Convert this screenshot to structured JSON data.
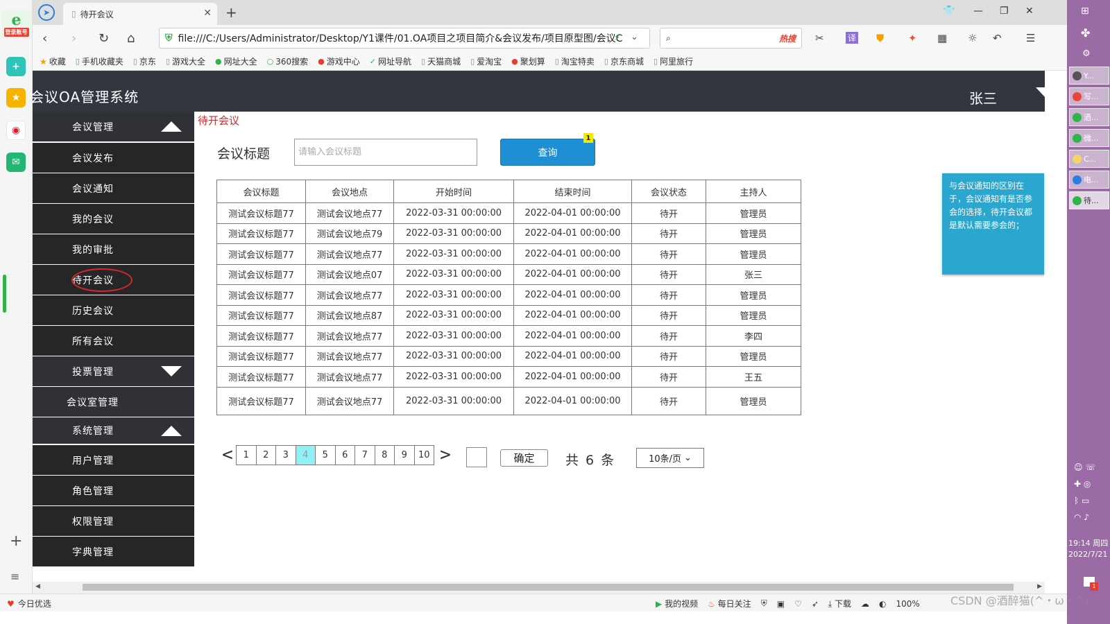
{
  "browser": {
    "tab_title": "待开会议",
    "url": "file:///C:/Users/Administrator/Desktop/Y1课件/01.OA项目之项目简介&会议发布/项目原型图/会议C",
    "search_hot": "热搜",
    "bookmarks": [
      "收藏",
      "手机收藏夹",
      "京东",
      "游戏大全",
      "网址大全",
      "360搜索",
      "游戏中心",
      "网址导航",
      "天猫商城",
      "爱淘宝",
      "聚划算",
      "淘宝特卖",
      "京东商城",
      "阿里旅行"
    ],
    "left_account_label": "登录账号"
  },
  "app": {
    "title": "会议OA管理系统",
    "user": "张三"
  },
  "menu": {
    "meeting_mgmt": "会议管理",
    "meeting_publish": "会议发布",
    "meeting_notice": "会议通知",
    "my_meetings": "我的会议",
    "my_approval": "我的审批",
    "pending_meetings": "待开会议",
    "history_meetings": "历史会议",
    "all_meetings": "所有会议",
    "vote_mgmt": "投票管理",
    "room_mgmt": "会议室管理",
    "system_mgmt": "系统管理",
    "user_mgmt": "用户管理",
    "role_mgmt": "角色管理",
    "perm_mgmt": "权限管理",
    "dict_mgmt": "字典管理"
  },
  "main": {
    "breadcrumb": "待开会议",
    "search_label": "会议标题",
    "search_placeholder": "请输入会议标题",
    "query_button": "查询",
    "query_badge": "1",
    "table": {
      "columns": [
        "会议标题",
        "会议地点",
        "开始时间",
        "结束时间",
        "会议状态",
        "主持人"
      ],
      "rows": [
        [
          "测试会议标题77",
          "测试会议地点77",
          "2022-03-31 00:00:00",
          "2022-04-01 00:00:00",
          "待开",
          "管理员"
        ],
        [
          "测试会议标题77",
          "测试会议地点79",
          "2022-03-31 00:00:00",
          "2022-04-01 00:00:00",
          "待开",
          "管理员"
        ],
        [
          "测试会议标题77",
          "测试会议地点77",
          "2022-03-31 00:00:00",
          "2022-04-01 00:00:00",
          "待开",
          "管理员"
        ],
        [
          "测试会议标题77",
          "测试会议地点07",
          "2022-03-31 00:00:00",
          "2022-04-01 00:00:00",
          "待开",
          "张三"
        ],
        [
          "测试会议标题77",
          "测试会议地点77",
          "2022-03-31 00:00:00",
          "2022-04-01 00:00:00",
          "待开",
          "管理员"
        ],
        [
          "测试会议标题77",
          "测试会议地点87",
          "2022-03-31 00:00:00",
          "2022-04-01 00:00:00",
          "待开",
          "管理员"
        ],
        [
          "测试会议标题77",
          "测试会议地点77",
          "2022-03-31 00:00:00",
          "2022-04-01 00:00:00",
          "待开",
          "李四"
        ],
        [
          "测试会议标题77",
          "测试会议地点77",
          "2022-03-31 00:00:00",
          "2022-04-01 00:00:00",
          "待开",
          "管理员"
        ],
        [
          "测试会议标题77",
          "测试会议地点77",
          "2022-03-31 00:00:00",
          "2022-04-01 00:00:00",
          "待开",
          "王五"
        ],
        [
          "测试会议标题77",
          "测试会议地点77",
          "2022-03-31 00:00:00",
          "2022-04-01 00:00:00",
          "待开",
          "管理员"
        ]
      ]
    },
    "pager": {
      "prev": "<",
      "next": ">",
      "pages": [
        "1",
        "2",
        "3",
        "4",
        "5",
        "6",
        "7",
        "8",
        "9",
        "10"
      ],
      "current_page": "4",
      "confirm": "确定",
      "total": "共 6 条",
      "page_size": "10条/页"
    },
    "note": "与会议通知的区别在于，会议通知有是否参会的选择，待开会议都是默认需要参会的；"
  },
  "desktop": {
    "tasks": [
      "Y...",
      "写...",
      "酒...",
      "微...",
      "C...",
      "电...",
      "待..."
    ],
    "time": "19:14 周四",
    "date": "2022/7/21"
  },
  "statusbar": {
    "left": "今日优选",
    "my_video": "我的视频",
    "daily_follow": "每日关注",
    "download": "下载",
    "zoom": "100%"
  },
  "watermark": "CSDN @酒醉猫(^・ω・^)",
  "colors": {
    "header_bg": "#33363f",
    "menu_bg": "#2f3137",
    "accent_red": "#d9262f",
    "query_blue": "#1e8fd2",
    "note_bg": "#2ba6cf",
    "active_page": "#8ff0f5"
  }
}
